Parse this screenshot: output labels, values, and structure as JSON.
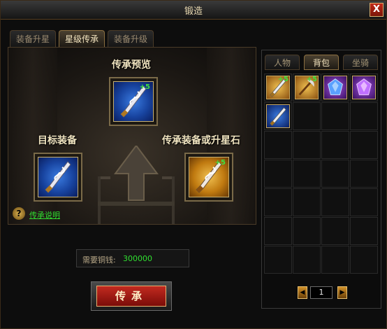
{
  "window": {
    "title": "锻造",
    "close_label": "X"
  },
  "tabs": [
    {
      "label": "装备升星",
      "active": false
    },
    {
      "label": "星级传承",
      "active": true
    },
    {
      "label": "装备升级",
      "active": false
    }
  ],
  "inherit": {
    "preview_label": "传承预览",
    "target_label": "目标装备",
    "source_label": "传承装备或升星石",
    "preview_item": {
      "icon": "spear-weapon-icon",
      "bonus": "+5",
      "frame": "blue"
    },
    "target_item": {
      "icon": "spear-weapon-icon",
      "bonus": "",
      "frame": "blue"
    },
    "source_item": {
      "icon": "spear-weapon-icon",
      "bonus": "+5",
      "frame": "gold"
    },
    "help_icon": "?",
    "help_link": "传承说明"
  },
  "cost": {
    "label": "需要铜钱:",
    "value": "300000"
  },
  "action_button": {
    "label": "传承"
  },
  "right_tabs": [
    {
      "label": "人物",
      "active": false
    },
    {
      "label": "背包",
      "active": true
    },
    {
      "label": "坐骑",
      "active": false
    }
  ],
  "bag": {
    "items": [
      {
        "icon": "spear-weapon-icon",
        "bonus": "+5",
        "frame": "gold"
      },
      {
        "icon": "scythe-weapon-icon",
        "bonus": "+5",
        "frame": "gold"
      },
      {
        "icon": "blue-gem-icon",
        "bonus": "",
        "frame": "purple"
      },
      {
        "icon": "purple-gem-icon",
        "bonus": "",
        "frame": "purple"
      },
      {
        "icon": "spear-weapon-icon",
        "bonus": "",
        "frame": "blue"
      }
    ],
    "page": "1"
  },
  "colors": {
    "accent_gold": "#c8a860",
    "bonus_green": "#40e040",
    "button_red": "#a81a14",
    "link_green": "#30e030"
  }
}
